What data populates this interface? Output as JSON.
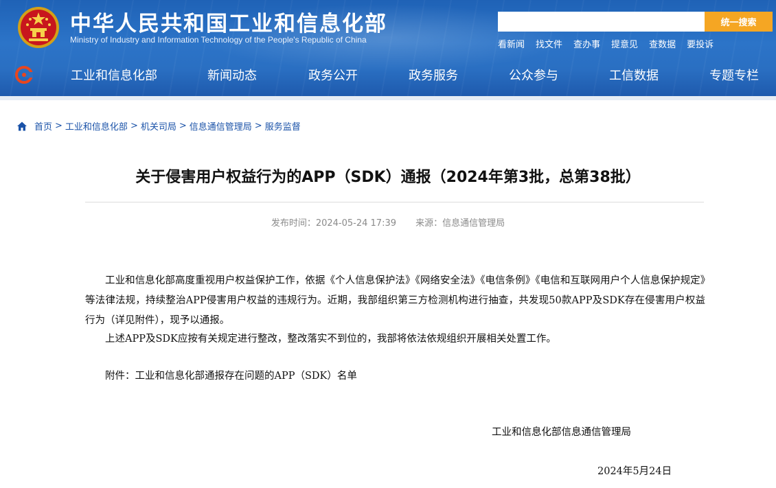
{
  "header": {
    "title": "中华人民共和国工业和信息化部",
    "subtitle": "Ministry of Industry and Information Technology of the People's Republic of China",
    "emblem_icon": "national-emblem-icon",
    "search": {
      "placeholder": "",
      "button_label": "统一搜索"
    },
    "quick_links": [
      "看新闻",
      "找文件",
      "查办事",
      "提意见",
      "查数据",
      "要投诉"
    ],
    "nav_items": [
      "工业和信息化部",
      "新闻动态",
      "政务公开",
      "政务服务",
      "公众参与",
      "工信数据",
      "专题专栏"
    ],
    "colors": {
      "header_blue": "#2c74c8",
      "search_button": "#f5a623"
    }
  },
  "breadcrumb": [
    "首页",
    "工业和信息化部",
    "机关司局",
    "信息通信管理局",
    "服务监督"
  ],
  "article": {
    "title": "关于侵害用户权益行为的APP（SDK）通报（2024年第3批，总第38批）",
    "publish_time": "发布时间：2024-05-24 17:39",
    "source": "来源：信息通信管理局",
    "paragraphs": [
      "工业和信息化部高度重视用户权益保护工作，依据《个人信息保护法》《网络安全法》《电信条例》《电信和互联网用户个人信息保护规定》等法律法规，持续整治APP侵害用户权益的违规行为。近期，我部组织第三方检测机构进行抽查，共发现50款APP及SDK存在侵害用户权益行为（详见附件），现予以通报。",
      "上述APP及SDK应按有关规定进行整改，整改落实不到位的，我部将依法依规组织开展相关处置工作。",
      "附件：工业和信息化部通报存在问题的APP（SDK）名单"
    ],
    "signature_org": "工业和信息化部信息通信管理局",
    "signature_date": "2024年5月24日"
  }
}
